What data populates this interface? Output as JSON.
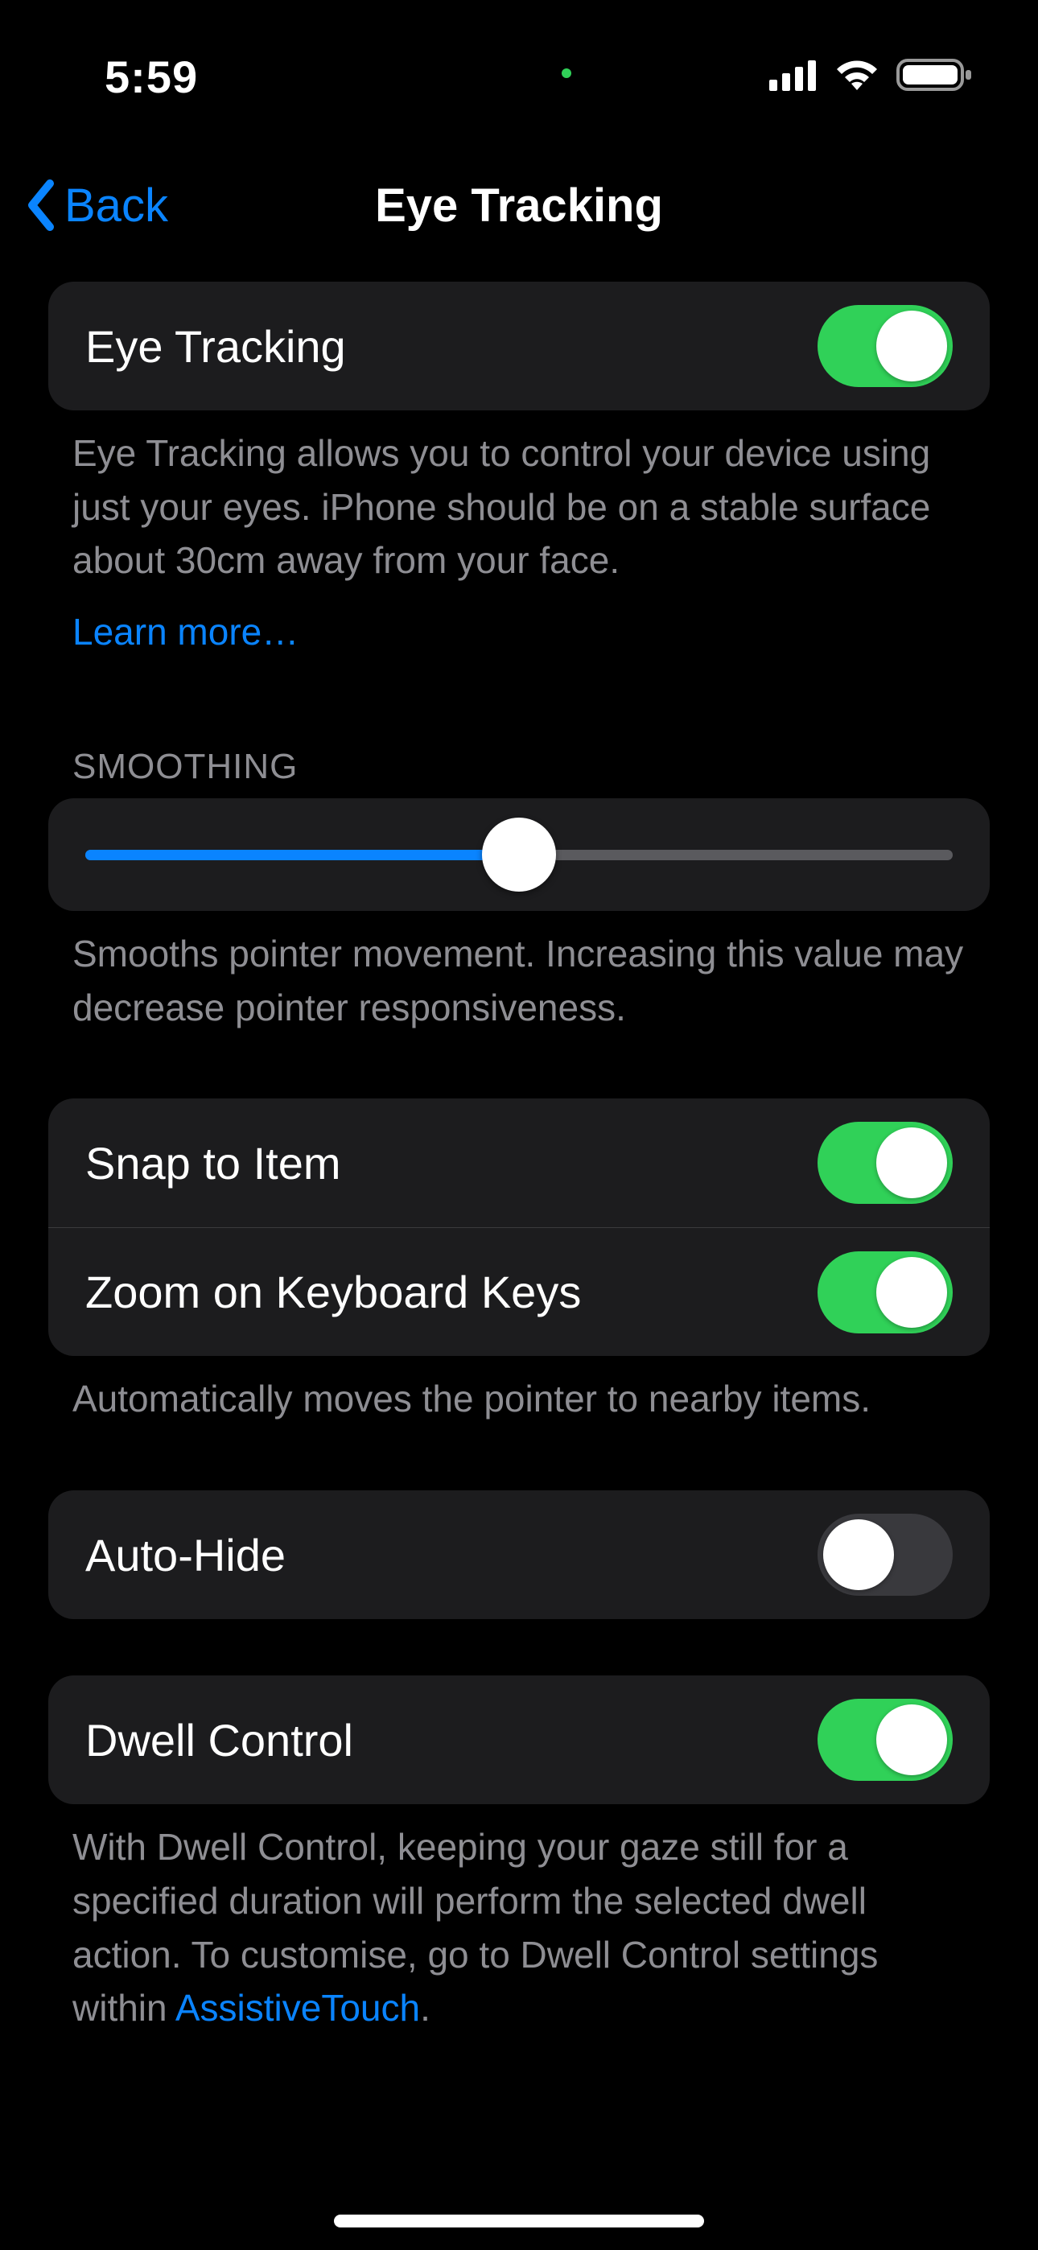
{
  "statusBar": {
    "time": "5:59",
    "cameraDot": true
  },
  "nav": {
    "backLabel": "Back",
    "title": "Eye Tracking"
  },
  "eyeTracking": {
    "label": "Eye Tracking",
    "on": true,
    "footer": "Eye Tracking allows you to control your device using just your eyes. iPhone should be on a stable surface about 30cm away from your face.",
    "learnMore": "Learn more…"
  },
  "smoothing": {
    "header": "SMOOTHING",
    "valuePercent": 50,
    "footer": "Smooths pointer movement. Increasing this value may decrease pointer responsiveness."
  },
  "snapZoom": {
    "snapLabel": "Snap to Item",
    "snapOn": true,
    "zoomLabel": "Zoom on Keyboard Keys",
    "zoomOn": true,
    "footer": "Automatically moves the pointer to nearby items."
  },
  "autoHide": {
    "label": "Auto-Hide",
    "on": false
  },
  "dwell": {
    "label": "Dwell Control",
    "on": true,
    "footerPrefix": "With Dwell Control, keeping your gaze still for a specified duration will perform the selected dwell action. To customise, go to Dwell Control settings within ",
    "footerLink": "AssistiveTouch",
    "footerSuffix": "."
  }
}
